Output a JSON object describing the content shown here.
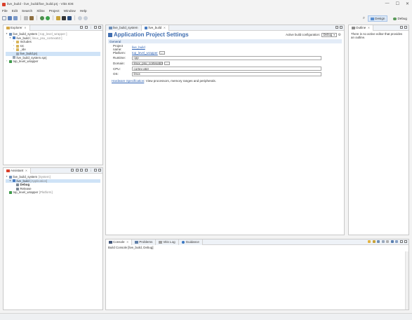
{
  "window": {
    "title": "live_build - live_build/live_build.prj - Vitis IDE",
    "controls": [
      "—",
      "☐",
      "✕"
    ]
  },
  "menu": [
    "File",
    "Edit",
    "Search",
    "Xilinx",
    "Project",
    "Window",
    "Help"
  ],
  "perspectives": [
    {
      "label": "Design",
      "active": true
    },
    {
      "label": "Debug",
      "active": false
    }
  ],
  "explorer": {
    "tab": "Explorer",
    "tree": [
      {
        "depth": 0,
        "twisty": "▾",
        "label": "live_build_system",
        "suffix": "[ top_level_wrapper ]",
        "icon": "system-icon"
      },
      {
        "depth": 1,
        "twisty": "▾",
        "label": "live_build",
        "suffix": "[ linux_psu_cortexa53 ]",
        "icon": "app-project-icon"
      },
      {
        "depth": 2,
        "twisty": "›",
        "label": "Includes",
        "suffix": "",
        "icon": "folder-icon"
      },
      {
        "depth": 2,
        "twisty": "›",
        "label": "src",
        "suffix": "",
        "icon": "folder-icon"
      },
      {
        "depth": 2,
        "twisty": "›",
        "label": "_ide",
        "suffix": "",
        "icon": "folder-icon"
      },
      {
        "depth": 2,
        "twisty": "",
        "label": "live_build.prj",
        "suffix": "",
        "icon": "file-icon",
        "selected": true
      },
      {
        "depth": 1,
        "twisty": "",
        "label": "live_build_system.sprj",
        "suffix": "",
        "icon": "file-icon"
      },
      {
        "depth": 0,
        "twisty": "›",
        "label": "top_level_wrapper",
        "suffix": "",
        "icon": "platform-icon"
      }
    ]
  },
  "assistant": {
    "tab": "Assistant",
    "tree": [
      {
        "depth": 0,
        "twisty": "▾",
        "label": "live_build_system",
        "suffix": "[System]",
        "icon": "system-icon"
      },
      {
        "depth": 1,
        "twisty": "▾",
        "label": "live_build",
        "suffix": "[Application]",
        "icon": "app-project-icon",
        "selected": true
      },
      {
        "depth": 2,
        "twisty": "",
        "label": "Debug",
        "suffix": "",
        "icon": "hammer-icon",
        "bold": true
      },
      {
        "depth": 2,
        "twisty": "",
        "label": "Release",
        "suffix": "",
        "icon": "hammer-icon"
      },
      {
        "depth": 0,
        "twisty": "",
        "label": "top_level_wrapper",
        "suffix": "[Platform]",
        "icon": "platform-icon"
      }
    ]
  },
  "editor": {
    "tabs": [
      {
        "label": "live_build_system",
        "active": false
      },
      {
        "label": "live_build",
        "active": true
      }
    ],
    "heading": "Application Project Settings",
    "build_config_label": "Active build configuration:",
    "build_config_value": "Debug",
    "section": "General",
    "fields": {
      "project_name_label": "Project name:",
      "project_name_value": "live_build",
      "platform_label": "Platform:",
      "platform_value": "top_level_wrapper",
      "runtime_label": "Runtime:",
      "runtime_value": "cpp",
      "domain_label": "Domain:",
      "domain_value": "linux_psu_cortexa53",
      "cpu_label": "CPU:",
      "cpu_value": "cortex-a53",
      "os_label": "OS:",
      "os_value": "linux"
    },
    "hw_spec_link": "Hardware Specification",
    "hw_spec_text": ": View processors, memory ranges and peripherals."
  },
  "outline": {
    "tab": "Outline",
    "message": "There is no active editor that provides an outline."
  },
  "bottom": {
    "tabs": [
      {
        "label": "Console",
        "active": true
      },
      {
        "label": "Problems",
        "active": false
      },
      {
        "label": "Vitis Log",
        "active": false
      },
      {
        "label": "Guidance",
        "active": false
      }
    ],
    "console_title": "Build Console [live_build, Debug]"
  },
  "colors": {
    "accent": "#3f6db0",
    "selection": "#cfe3f7",
    "link": "#2f63b5"
  }
}
